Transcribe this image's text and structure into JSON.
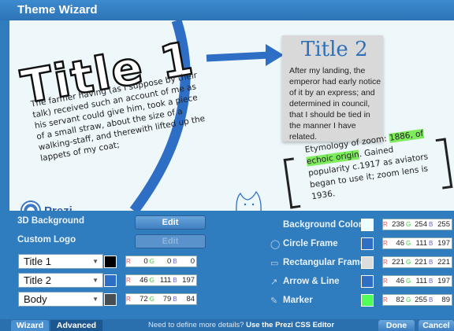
{
  "window": {
    "title": "Theme Wizard"
  },
  "preview": {
    "title1": "Title 1",
    "title1_body": "The farmer having (as I suppose by their talk) received such an account of me as his servant could give him, took a piece of a small straw, about the size of a walking-staff, and therewith lifted up the lappets of my coat;",
    "title2": "Title 2",
    "title2_body": "After my landing, the emperor had early notice of it by an express; and determined in council, that I should be tied in the manner I have related.",
    "zoom_text_before": "Etymology of zoom:",
    "zoom_highlight": "1886, of echoic origin",
    "zoom_text_after": ". Gained popularity c.1917 as aviators began to use it; zoom lens is 1936.",
    "logo_text": "Prezi"
  },
  "left_panel": {
    "bg3d_label": "3D Background",
    "bg3d_button": "Edit",
    "logo_label": "Custom Logo",
    "logo_button": "Edit",
    "fonts": [
      {
        "name": "Title 1",
        "color": "#000000",
        "r": "0",
        "g": "0",
        "b": "0"
      },
      {
        "name": "Title 2",
        "color": "#2e6fc5",
        "r": "46",
        "g": "111",
        "b": "197"
      },
      {
        "name": "Body",
        "color": "#484f54",
        "r": "72",
        "g": "79",
        "b": "84"
      }
    ]
  },
  "right_panel": {
    "items": [
      {
        "label": "Background Color",
        "icon": "",
        "color": "#eefeff",
        "r": "238",
        "g": "254",
        "b": "255"
      },
      {
        "label": "Circle Frame",
        "icon": "circle-icon",
        "color": "#2e6fc5",
        "r": "46",
        "g": "111",
        "b": "197"
      },
      {
        "label": "Rectangular Frames",
        "icon": "rectangle-icon",
        "color": "#dddddd",
        "r": "221",
        "g": "221",
        "b": "221"
      },
      {
        "label": "Arrow & Line",
        "icon": "arrow-icon",
        "color": "#2e6fc5",
        "r": "46",
        "g": "111",
        "b": "197"
      },
      {
        "label": "Marker",
        "icon": "marker-icon",
        "color": "#52ff59",
        "r": "82",
        "g": "255",
        "b": "89"
      }
    ]
  },
  "footer": {
    "tab_wizard": "Wizard",
    "tab_advanced": "Advanced",
    "help_text": "Need to define more details?",
    "help_link": "Use the Prezi CSS Editor",
    "done": "Done",
    "cancel": "Cancel"
  },
  "labels": {
    "r": "R",
    "g": "G",
    "b": "B"
  }
}
